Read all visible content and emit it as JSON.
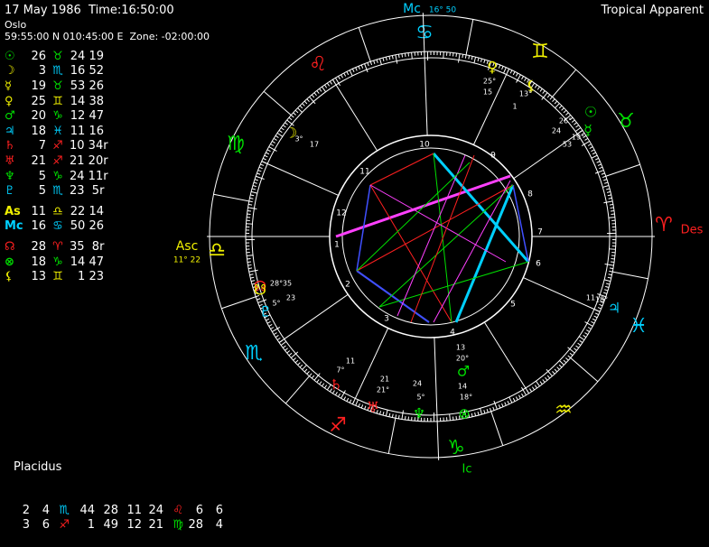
{
  "header": {
    "date_time": "17 May 1986  Time:16:50:00",
    "place": "Oslo",
    "coords": "59:55:00 N 010:45:00 E  Zone: -02:00:00",
    "mode": "Tropical Apparent"
  },
  "colors": {
    "green": "#00e000",
    "yellow": "#f0f000",
    "red": "#ff2020",
    "cyan": "#00d0ff",
    "magenta": "#ff40ff",
    "white": "#ffffff",
    "blue": "#4050ff"
  },
  "planets": [
    {
      "glyph": "☉",
      "gcolor": "#00e000",
      "deg": "26",
      "sign": "♉",
      "scolor": "#00e000",
      "min": "24 19"
    },
    {
      "glyph": "☽",
      "gcolor": "#f0f000",
      "deg": "3",
      "sign": "♏",
      "scolor": "#00d0ff",
      "min": "16 52"
    },
    {
      "glyph": "☿",
      "gcolor": "#f0f000",
      "deg": "19",
      "sign": "♉",
      "scolor": "#00e000",
      "min": "53 26"
    },
    {
      "glyph": "♀",
      "gcolor": "#f0f000",
      "deg": "25",
      "sign": "♊",
      "scolor": "#f0f000",
      "min": "14 38"
    },
    {
      "glyph": "♂",
      "gcolor": "#00e000",
      "deg": "20",
      "sign": "♑",
      "scolor": "#00e000",
      "min": "12 47"
    },
    {
      "glyph": "♃",
      "gcolor": "#00d0ff",
      "deg": "18",
      "sign": "♓",
      "scolor": "#00d0ff",
      "min": "11 16"
    },
    {
      "glyph": "♄",
      "gcolor": "#ff2020",
      "deg": "7",
      "sign": "♐",
      "scolor": "#ff2020",
      "min": "10 34r"
    },
    {
      "glyph": "♅",
      "gcolor": "#ff2020",
      "deg": "21",
      "sign": "♐",
      "scolor": "#ff2020",
      "min": "21 20r"
    },
    {
      "glyph": "♆",
      "gcolor": "#00e000",
      "deg": "5",
      "sign": "♑",
      "scolor": "#00e000",
      "min": "24 11r"
    },
    {
      "glyph": "♇",
      "gcolor": "#00d0ff",
      "deg": "5",
      "sign": "♏",
      "scolor": "#00d0ff",
      "min": "23  5r"
    }
  ],
  "angles": [
    {
      "glyph": "As",
      "gcolor": "#f0f000",
      "deg": "11",
      "sign": "♎",
      "scolor": "#f0f000",
      "min": "22 14"
    },
    {
      "glyph": "Mc",
      "gcolor": "#00d0ff",
      "deg": "16",
      "sign": "♋",
      "scolor": "#00d0ff",
      "min": "50 26"
    }
  ],
  "points": [
    {
      "glyph": "☊",
      "gcolor": "#ff2020",
      "deg": "28",
      "sign": "♈",
      "scolor": "#ff2020",
      "min": "35  8r"
    },
    {
      "glyph": "⊗",
      "gcolor": "#00e000",
      "deg": "18",
      "sign": "♑",
      "scolor": "#00e000",
      "min": "14 47"
    },
    {
      "glyph": "⚸",
      "gcolor": "#f0f000",
      "deg": "13",
      "sign": "♊",
      "scolor": "#f0f000",
      "min": " 1 23"
    }
  ],
  "houses": {
    "title": "Placidus",
    "rows": [
      [
        "2",
        "4",
        "♏",
        "44",
        "28",
        "11",
        "24",
        "♌",
        "6",
        "6"
      ],
      [
        "3",
        "6",
        "♐",
        "1",
        "49",
        "12",
        "21",
        "♍",
        "28",
        "4"
      ]
    ]
  },
  "chart": {
    "mc_label": "Mc",
    "mc_deg": "16° 50",
    "asc_label": "Asc",
    "asc_deg": "11° 22",
    "des_label": "Des",
    "ic_label": "Ic",
    "house_numbers": [
      "1",
      "2",
      "3",
      "4",
      "5",
      "6",
      "7",
      "8",
      "9",
      "10",
      "11",
      "12"
    ],
    "zodiac_glyphs": [
      {
        "g": "♈",
        "c": "#ff2020"
      },
      {
        "g": "♉",
        "c": "#00e000"
      },
      {
        "g": "♊",
        "c": "#f0f000"
      },
      {
        "g": "♋",
        "c": "#00d0ff"
      },
      {
        "g": "♌",
        "c": "#ff2020"
      },
      {
        "g": "♍",
        "c": "#00e000"
      },
      {
        "g": "♎",
        "c": "#f0f000"
      },
      {
        "g": "♏",
        "c": "#00d0ff"
      },
      {
        "g": "♐",
        "c": "#ff2020"
      },
      {
        "g": "♑",
        "c": "#00e000"
      },
      {
        "g": "♒",
        "c": "#f0f000"
      },
      {
        "g": "♓",
        "c": "#00d0ff"
      }
    ],
    "placements": [
      {
        "g": "♀",
        "c": "#f0f000",
        "t1": "25°",
        "t2": "15"
      },
      {
        "g": "⚸",
        "c": "#f0f000",
        "t1": "13°",
        "t2": "1"
      },
      {
        "g": "☉",
        "c": "#00e000",
        "t1": "26°",
        "t2": "24"
      },
      {
        "g": "☿",
        "c": "#00e000",
        "t1": "19°",
        "t2": "53"
      },
      {
        "g": "☽",
        "c": "#f0f000",
        "t1": "3°",
        "t2": "17"
      },
      {
        "g": "☊",
        "c": "#ff2020",
        "t1": "28°",
        "t2": "35"
      },
      {
        "g": "♃",
        "c": "#00d0ff",
        "t1": "18°",
        "t2": "11"
      },
      {
        "g": "♂",
        "c": "#00e000",
        "t1": "20°",
        "t2": "13"
      },
      {
        "g": "⊗",
        "c": "#00e000",
        "t1": "18°",
        "t2": "14"
      },
      {
        "g": "♆",
        "c": "#00e000",
        "t1": "5°",
        "t2": "24"
      },
      {
        "g": "♅",
        "c": "#ff2020",
        "t1": "21°",
        "t2": "21"
      },
      {
        "g": "♄",
        "c": "#ff2020",
        "t1": "7°",
        "t2": "11"
      },
      {
        "g": "♇",
        "c": "#00d0ff",
        "t1": "5°",
        "t2": "23"
      },
      {
        "g": "☋",
        "c": "#f0f000",
        "t1": "28°",
        "t2": "35"
      }
    ]
  }
}
